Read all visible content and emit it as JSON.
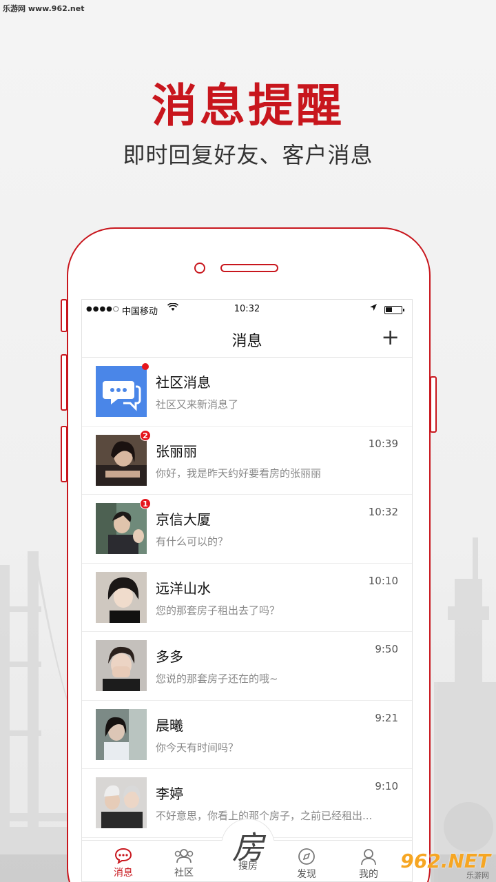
{
  "watermark": {
    "top_left": "乐游网 www.962.net",
    "bottom_right": "962.NET",
    "bottom_right_sub": "乐游网"
  },
  "promo": {
    "headline": "消息提醒",
    "subheadline": "即时回复好友、客户消息"
  },
  "statusbar": {
    "signal": "●●●●○",
    "carrier": "中国移动",
    "wifi": "wifi-icon",
    "time": "10:32"
  },
  "navbar": {
    "title": "消息",
    "add_label": "+"
  },
  "messages": [
    {
      "name": "社区消息",
      "preview": "社区又来新消息了",
      "time": "",
      "badge": "",
      "dot": true,
      "avatar": "chat-bubble-icon"
    },
    {
      "name": "张丽丽",
      "preview": "你好，我是昨天约好要看房的张丽丽",
      "time": "10:39",
      "badge": "2"
    },
    {
      "name": "京信大厦",
      "preview": "有什么可以的？",
      "time": "10:32",
      "badge": "1"
    },
    {
      "name": "远洋山水",
      "preview": "您的那套房子租出去了吗？",
      "time": "10:10",
      "badge": ""
    },
    {
      "name": "多多",
      "preview": "您说的那套房子还在的哦~",
      "time": "9:50",
      "badge": ""
    },
    {
      "name": "晨曦",
      "preview": "你今天有时间吗？",
      "time": "9:21",
      "badge": ""
    },
    {
      "name": "李婷",
      "preview": "不好意思，你看上的那个房子，之前已经租出...",
      "time": "9:10",
      "badge": ""
    }
  ],
  "tabbar": {
    "tabs": [
      {
        "label": "消息",
        "icon": "chat-icon",
        "active": true
      },
      {
        "label": "社区",
        "icon": "people-icon"
      },
      {
        "label": "搜房",
        "icon": "fang-char",
        "center_char": "房"
      },
      {
        "label": "发现",
        "icon": "compass-icon"
      },
      {
        "label": "我的",
        "icon": "person-icon"
      }
    ]
  },
  "colors": {
    "accent": "#c8161d",
    "badge": "#e5161d",
    "community_avatar": "#4a86e8"
  }
}
